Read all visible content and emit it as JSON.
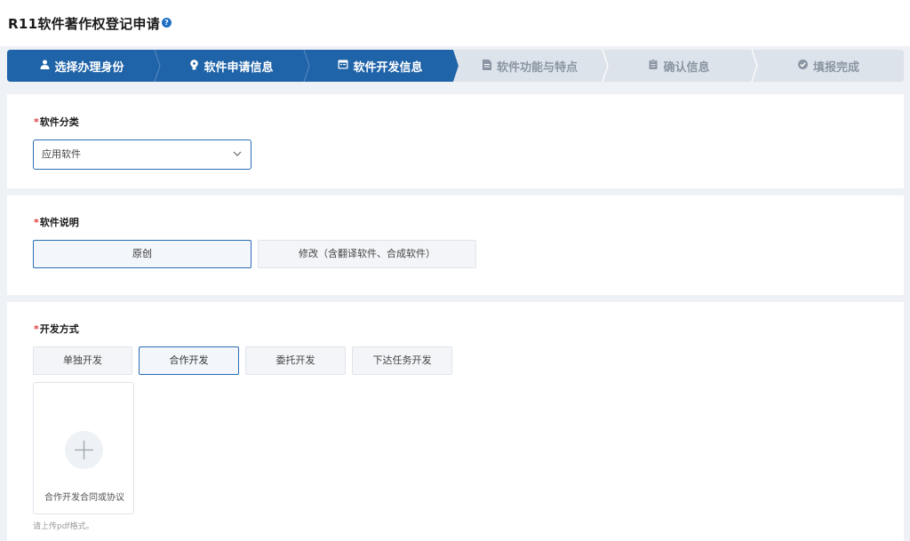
{
  "header": {
    "title": "R11软件著作权登记申请",
    "help_icon": "?"
  },
  "stepper": {
    "colors": {
      "active": "#1f63a8",
      "inactive": "#dde3ea"
    },
    "steps": [
      {
        "label": "选择办理身份",
        "icon": "user-icon",
        "glyph": "👤",
        "state": "active"
      },
      {
        "label": "软件申请信息",
        "icon": "lightbulb-icon",
        "glyph": "⚙",
        "state": "active"
      },
      {
        "label": "软件开发信息",
        "icon": "window-icon",
        "glyph": "▣",
        "state": "active"
      },
      {
        "label": "软件功能与特点",
        "icon": "document-icon",
        "glyph": "▤",
        "state": "inactive"
      },
      {
        "label": "确认信息",
        "icon": "clipboard-icon",
        "glyph": "▥",
        "state": "inactive"
      },
      {
        "label": "填报完成",
        "icon": "check-circle-icon",
        "glyph": "✔",
        "state": "inactive"
      }
    ]
  },
  "software_category": {
    "required_mark": "*",
    "label": "软件分类",
    "value": "应用软件"
  },
  "software_description": {
    "required_mark": "*",
    "label": "软件说明",
    "options": [
      {
        "label": "原创",
        "selected": true
      },
      {
        "label": "修改（含翻译软件、合成软件）",
        "selected": false
      }
    ]
  },
  "development_method": {
    "required_mark": "*",
    "label": "开发方式",
    "options": [
      {
        "label": "单独开发",
        "selected": false
      },
      {
        "label": "合作开发",
        "selected": true
      },
      {
        "label": "委托开发",
        "selected": false
      },
      {
        "label": "下达任务开发",
        "selected": false
      }
    ],
    "upload": {
      "label": "合作开发合同或协议",
      "icon": "plus-icon"
    },
    "hint": "请上传pdf格式。"
  }
}
